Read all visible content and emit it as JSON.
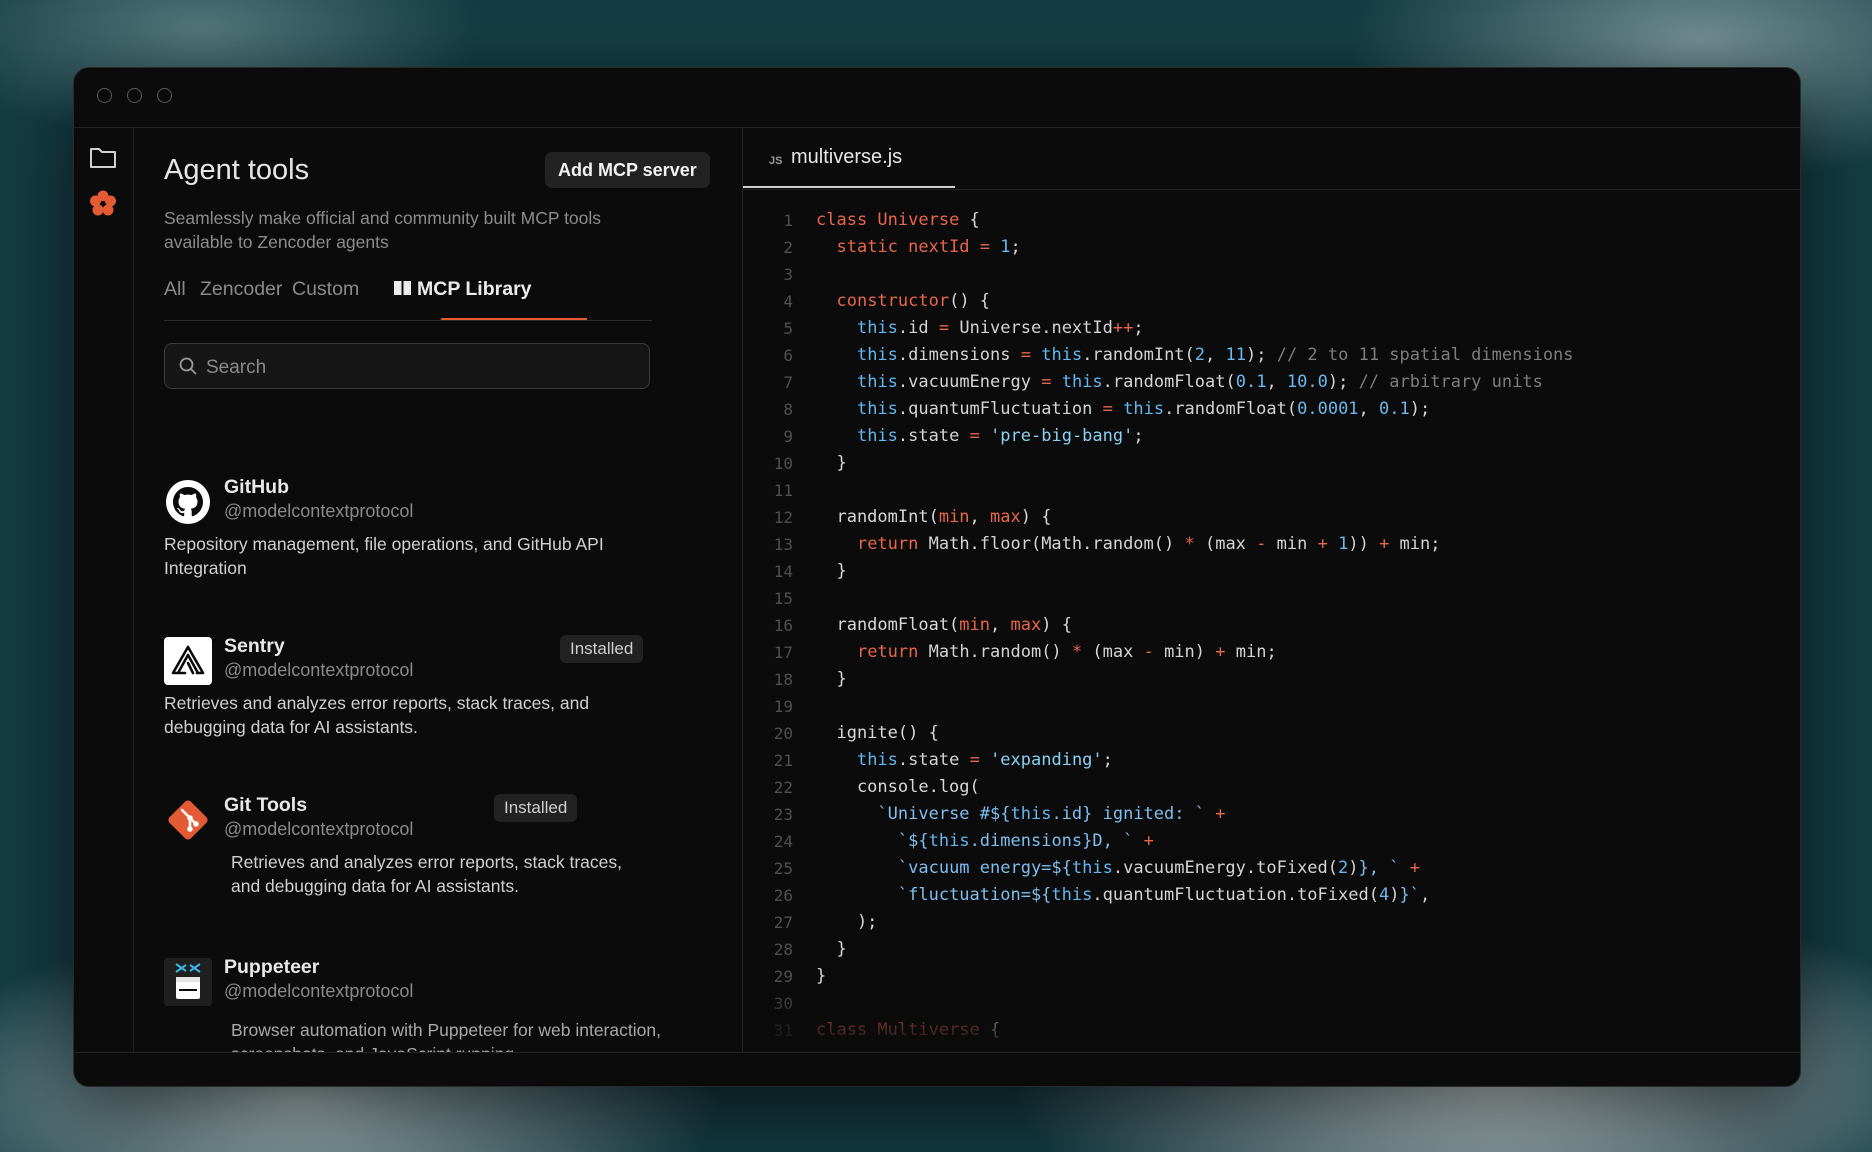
{
  "window": {
    "traffic_lights": [
      "close",
      "minimize",
      "maximize"
    ]
  },
  "rail": {
    "icons": [
      "folder-icon",
      "zencoder-logo-icon"
    ],
    "accent": "#e25b35"
  },
  "panel": {
    "title": "Agent tools",
    "add_button": "Add MCP server",
    "subtitle": "Seamlessly make official and community built MCP tools available to Zencoder agents",
    "tabs": [
      {
        "label": "All",
        "active": false
      },
      {
        "label": "Zencoder",
        "active": false
      },
      {
        "label": "Custom",
        "active": false
      },
      {
        "label": "MCP Library",
        "active": true,
        "icon": "book-icon"
      }
    ],
    "search": {
      "placeholder": "Search"
    },
    "servers": [
      {
        "name": "GitHub",
        "handle": "@modelcontextprotocol",
        "description": "Repository management, file operations, and GitHub API Integration",
        "installed": false,
        "icon": "github-icon"
      },
      {
        "name": "Sentry",
        "handle": "@modelcontextprotocol",
        "description": "Retrieves and analyzes error reports, stack traces, and debugging data for AI assistants.",
        "installed": true,
        "badge": "Installed",
        "icon": "sentry-icon"
      },
      {
        "name": "Git Tools",
        "handle": "@modelcontextprotocol",
        "description": "Retrieves and analyzes error reports, stack traces, and debugging data for AI assistants.",
        "installed": true,
        "badge": "Installed",
        "icon": "git-icon"
      },
      {
        "name": "Puppeteer",
        "handle": "@modelcontextprotocol",
        "description": "Browser automation with Puppeteer for web interaction, screenshots, and JavaScript running.",
        "installed": false,
        "icon": "puppeteer-icon"
      }
    ]
  },
  "editor": {
    "file_type": "JS",
    "file_name": "multiverse.js",
    "lines": [
      [
        [
          "k",
          "class "
        ],
        [
          "k",
          "Universe"
        ],
        [
          "p",
          " {"
        ]
      ],
      [
        [
          "p",
          "  "
        ],
        [
          "k",
          "static nextId"
        ],
        [
          "p",
          " "
        ],
        [
          "k",
          "="
        ],
        [
          "p",
          " "
        ],
        [
          "n",
          "1"
        ],
        [
          "p",
          ";"
        ]
      ],
      [],
      [
        [
          "p",
          "  "
        ],
        [
          "k",
          "constructor"
        ],
        [
          "p",
          "() {"
        ]
      ],
      [
        [
          "p",
          "    "
        ],
        [
          "b",
          "this"
        ],
        [
          "d",
          ".id "
        ],
        [
          "k",
          "="
        ],
        [
          "d",
          " Universe.nextId"
        ],
        [
          "k",
          "++"
        ],
        [
          "d",
          ";"
        ]
      ],
      [
        [
          "p",
          "    "
        ],
        [
          "b",
          "this"
        ],
        [
          "d",
          ".dimensions "
        ],
        [
          "k",
          "="
        ],
        [
          "d",
          " "
        ],
        [
          "b",
          "this"
        ],
        [
          "d",
          ".randomInt("
        ],
        [
          "n",
          "2"
        ],
        [
          "d",
          ", "
        ],
        [
          "n",
          "11"
        ],
        [
          "d",
          "); "
        ],
        [
          "c",
          "// 2 to 11 spatial dimensions"
        ]
      ],
      [
        [
          "p",
          "    "
        ],
        [
          "b",
          "this"
        ],
        [
          "d",
          ".vacuumEnergy "
        ],
        [
          "k",
          "="
        ],
        [
          "d",
          " "
        ],
        [
          "b",
          "this"
        ],
        [
          "d",
          ".randomFloat("
        ],
        [
          "n",
          "0.1"
        ],
        [
          "d",
          ", "
        ],
        [
          "n",
          "10.0"
        ],
        [
          "d",
          "); "
        ],
        [
          "c",
          "// arbitrary units"
        ]
      ],
      [
        [
          "p",
          "    "
        ],
        [
          "b",
          "this"
        ],
        [
          "d",
          ".quantumFluctuation "
        ],
        [
          "k",
          "="
        ],
        [
          "d",
          " "
        ],
        [
          "b",
          "this"
        ],
        [
          "d",
          ".randomFloat("
        ],
        [
          "n",
          "0.0001"
        ],
        [
          "d",
          ", "
        ],
        [
          "n",
          "0.1"
        ],
        [
          "d",
          ");"
        ]
      ],
      [
        [
          "p",
          "    "
        ],
        [
          "b",
          "this"
        ],
        [
          "d",
          ".state "
        ],
        [
          "k",
          "="
        ],
        [
          "d",
          " "
        ],
        [
          "s",
          "'pre-big-bang'"
        ],
        [
          "d",
          ";"
        ]
      ],
      [
        [
          "p",
          "  }"
        ]
      ],
      [],
      [
        [
          "p",
          "  randomInt("
        ],
        [
          "k",
          "min"
        ],
        [
          "p",
          ", "
        ],
        [
          "k",
          "max"
        ],
        [
          "p",
          ") {"
        ]
      ],
      [
        [
          "p",
          "    "
        ],
        [
          "k",
          "return"
        ],
        [
          "d",
          " Math.floor(Math.random() "
        ],
        [
          "k",
          "*"
        ],
        [
          "d",
          " (max "
        ],
        [
          "k",
          "-"
        ],
        [
          "d",
          " min "
        ],
        [
          "k",
          "+"
        ],
        [
          "d",
          " "
        ],
        [
          "n",
          "1"
        ],
        [
          "d",
          ")) "
        ],
        [
          "k",
          "+"
        ],
        [
          "d",
          " min;"
        ]
      ],
      [
        [
          "p",
          "  }"
        ]
      ],
      [],
      [
        [
          "p",
          "  randomFloat("
        ],
        [
          "k",
          "min"
        ],
        [
          "p",
          ", "
        ],
        [
          "k",
          "max"
        ],
        [
          "p",
          ") {"
        ]
      ],
      [
        [
          "p",
          "    "
        ],
        [
          "k",
          "return"
        ],
        [
          "d",
          " Math.random() "
        ],
        [
          "k",
          "*"
        ],
        [
          "d",
          " (max "
        ],
        [
          "k",
          "-"
        ],
        [
          "d",
          " min) "
        ],
        [
          "k",
          "+"
        ],
        [
          "d",
          " min;"
        ]
      ],
      [
        [
          "p",
          "  }"
        ]
      ],
      [],
      [
        [
          "p",
          "  ignite() {"
        ]
      ],
      [
        [
          "p",
          "    "
        ],
        [
          "b",
          "this"
        ],
        [
          "d",
          ".state "
        ],
        [
          "k",
          "="
        ],
        [
          "d",
          " "
        ],
        [
          "s",
          "'expanding'"
        ],
        [
          "d",
          ";"
        ]
      ],
      [
        [
          "p",
          "    console.log("
        ]
      ],
      [
        [
          "p",
          "      "
        ],
        [
          "t",
          "`Universe #${"
        ],
        [
          "b",
          "this"
        ],
        [
          "t",
          ".id} ignited: `"
        ],
        [
          "d",
          " "
        ],
        [
          "k",
          "+"
        ]
      ],
      [
        [
          "p",
          "        "
        ],
        [
          "t",
          "`${"
        ],
        [
          "b",
          "this"
        ],
        [
          "t",
          ".dimensions}D, `"
        ],
        [
          "d",
          " "
        ],
        [
          "k",
          "+"
        ]
      ],
      [
        [
          "p",
          "        "
        ],
        [
          "t",
          "`vacuum energy=${"
        ],
        [
          "b",
          "this"
        ],
        [
          "d",
          ".vacuumEnergy.toFixed("
        ],
        [
          "n",
          "2"
        ],
        [
          "d",
          ")"
        ],
        [
          "t",
          "}, `"
        ],
        [
          "d",
          " "
        ],
        [
          "k",
          "+"
        ]
      ],
      [
        [
          "p",
          "        "
        ],
        [
          "t",
          "`fluctuation=${"
        ],
        [
          "b",
          "this"
        ],
        [
          "d",
          ".quantumFluctuation.toFixed("
        ],
        [
          "n",
          "4"
        ],
        [
          "d",
          ")"
        ],
        [
          "t",
          "}`"
        ],
        [
          "d",
          ","
        ]
      ],
      [
        [
          "p",
          "    );"
        ]
      ],
      [
        [
          "p",
          "  }"
        ]
      ],
      [
        [
          "p",
          "}"
        ]
      ],
      [],
      [
        [
          "k",
          "class "
        ],
        [
          "k",
          "Multiverse"
        ],
        [
          "p",
          " {"
        ]
      ]
    ]
  }
}
